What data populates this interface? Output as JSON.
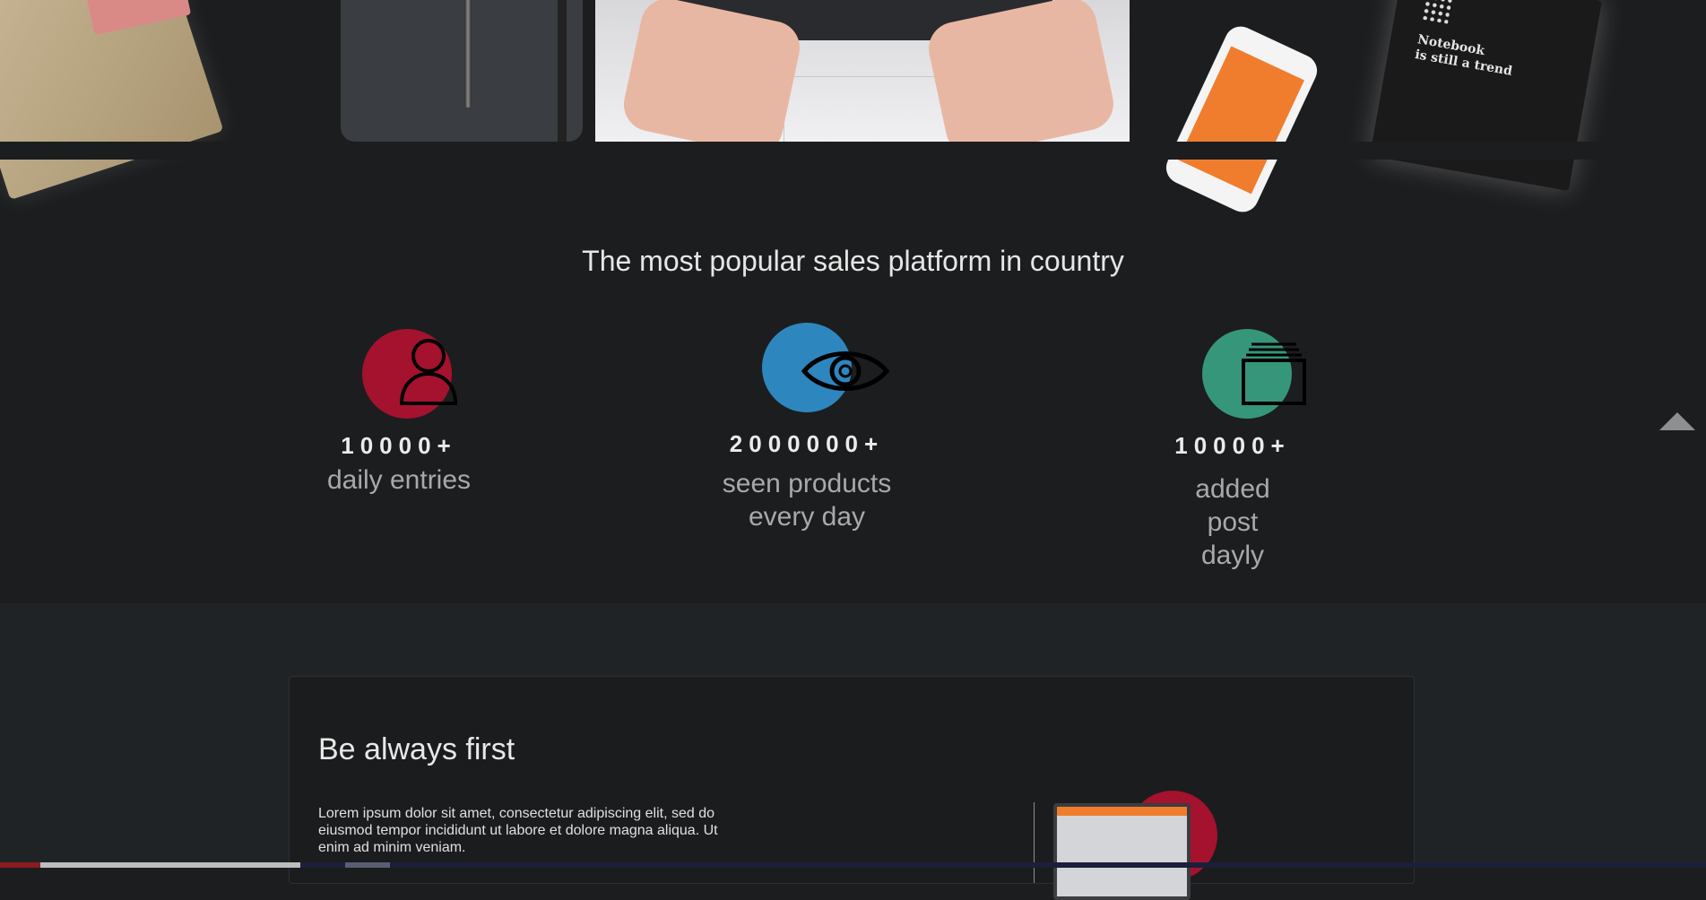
{
  "hero": {
    "notebook_text_line1": "Notebook",
    "notebook_text_line2": "is still a trend"
  },
  "headline": "The most popular sales platform in country",
  "stats": [
    {
      "icon": "user-icon",
      "color": "#a4122e",
      "number": "10000+",
      "label_lines": [
        "daily entries"
      ]
    },
    {
      "icon": "eye-icon",
      "color": "#2e86be",
      "number": "2000000+",
      "label_lines": [
        "seen products",
        "every day"
      ]
    },
    {
      "icon": "stack-icon",
      "color": "#36967a",
      "number": "10000+",
      "label_lines": [
        "added",
        "post",
        "dayly"
      ]
    }
  ],
  "scroll_top": {
    "icon": "triangle-up-icon"
  },
  "feature_card": {
    "title": "Be always first",
    "body": "Lorem ipsum dolor sit amet, consectetur adipiscing elit, sed do eiusmod tempor incididunt ut labore et dolore magna aliqua. Ut enim ad minim veniam.",
    "accent_color": "#a4122e"
  }
}
